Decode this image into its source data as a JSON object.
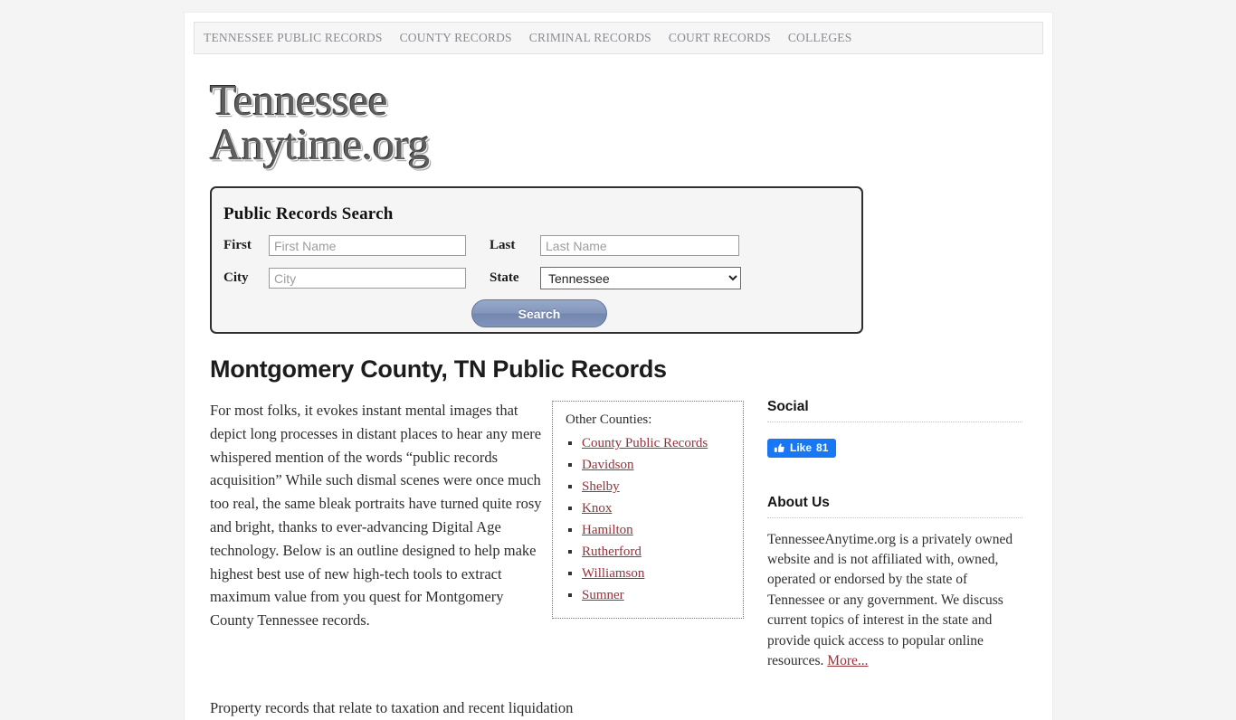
{
  "nav": {
    "items": [
      {
        "label": "Tennessee Public Records"
      },
      {
        "label": "County Records"
      },
      {
        "label": "Criminal Records"
      },
      {
        "label": "Court Records"
      },
      {
        "label": "Colleges"
      }
    ]
  },
  "logo": {
    "line1": "Tennessee",
    "line2": "Anytime.org"
  },
  "search": {
    "title": "Public Records Search",
    "first_label": "First",
    "first_placeholder": "First Name",
    "first_value": "",
    "last_label": "Last",
    "last_placeholder": "Last Name",
    "last_value": "",
    "city_label": "City",
    "city_placeholder": "City",
    "city_value": "",
    "state_label": "State",
    "state_selected": "Tennessee",
    "state_options": [
      "Tennessee"
    ],
    "button_label": "Search",
    "button_color": "#7f93b8"
  },
  "main": {
    "heading": "Montgomery County, TN Public Records",
    "paragraph1": "For most folks, it evokes instant mental images that depict long processes in distant places to hear any mere whispered mention of the words “public records acquisition” While such dismal scenes were once much too real, the same bleak portraits have turned quite rosy and bright, thanks to ever-advancing Digital Age technology. Below is an outline designed to help make highest best use of new high-tech tools to extract maximum value from you quest for Montgomery County Tennessee records.",
    "paragraph2": "Property records that relate to taxation and recent liquidation"
  },
  "counties": {
    "title": "Other Counties:",
    "link_color": "#97323a",
    "items": [
      {
        "label": "County Public Records"
      },
      {
        "label": "Davidson"
      },
      {
        "label": "Shelby"
      },
      {
        "label": "Knox"
      },
      {
        "label": "Hamilton"
      },
      {
        "label": "Rutherford"
      },
      {
        "label": "Williamson"
      },
      {
        "label": "Sumner"
      }
    ]
  },
  "sidebar": {
    "social_heading": "Social",
    "facebook": {
      "label": "Like",
      "count": "81",
      "icon": "thumbs-up-icon",
      "brand_color": "#1877f2"
    },
    "about_heading": "About Us",
    "about_text": "TennesseeAnytime.org is a privately owned website and is not affiliated with, owned, operated or endorsed by the state of Tennessee or any government. We discuss current topics of interest in the state and provide quick access to popular online resources. ",
    "about_more": "More..."
  }
}
